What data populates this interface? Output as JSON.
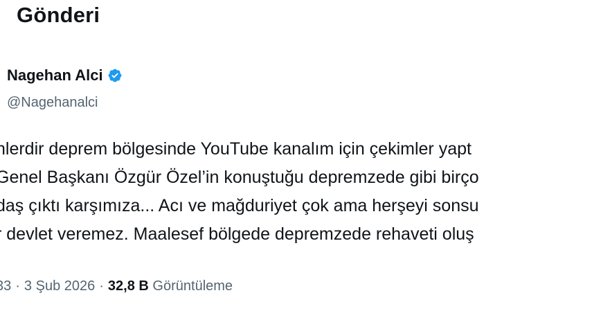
{
  "header": {
    "title": "Gönderi"
  },
  "author": {
    "name": "Nagehan Alci",
    "handle": "@Nagehanalci"
  },
  "tweet": {
    "lines": [
      "nlerdir deprem bölgesinde YouTube kanalım için çekimler yapt",
      "Genel Başkanı Özgür Özel’in konuştuğu depremzede gibi birço",
      "daş çıktı karşımıza... Acı ve mağduriyet çok ama herşeyi sonsu",
      "r devlet veremez. Maalesef bölgede depremzede rehaveti oluş"
    ]
  },
  "meta": {
    "time": "33",
    "separator": "·",
    "date": "3 Şub 2026",
    "views_count": "32,8 B",
    "views_label": "Görüntüleme"
  },
  "colors": {
    "text": "#0f1419",
    "secondary": "#536471",
    "verified": "#1d9bf0"
  },
  "icons": {
    "verified": "verified-badge-icon"
  }
}
